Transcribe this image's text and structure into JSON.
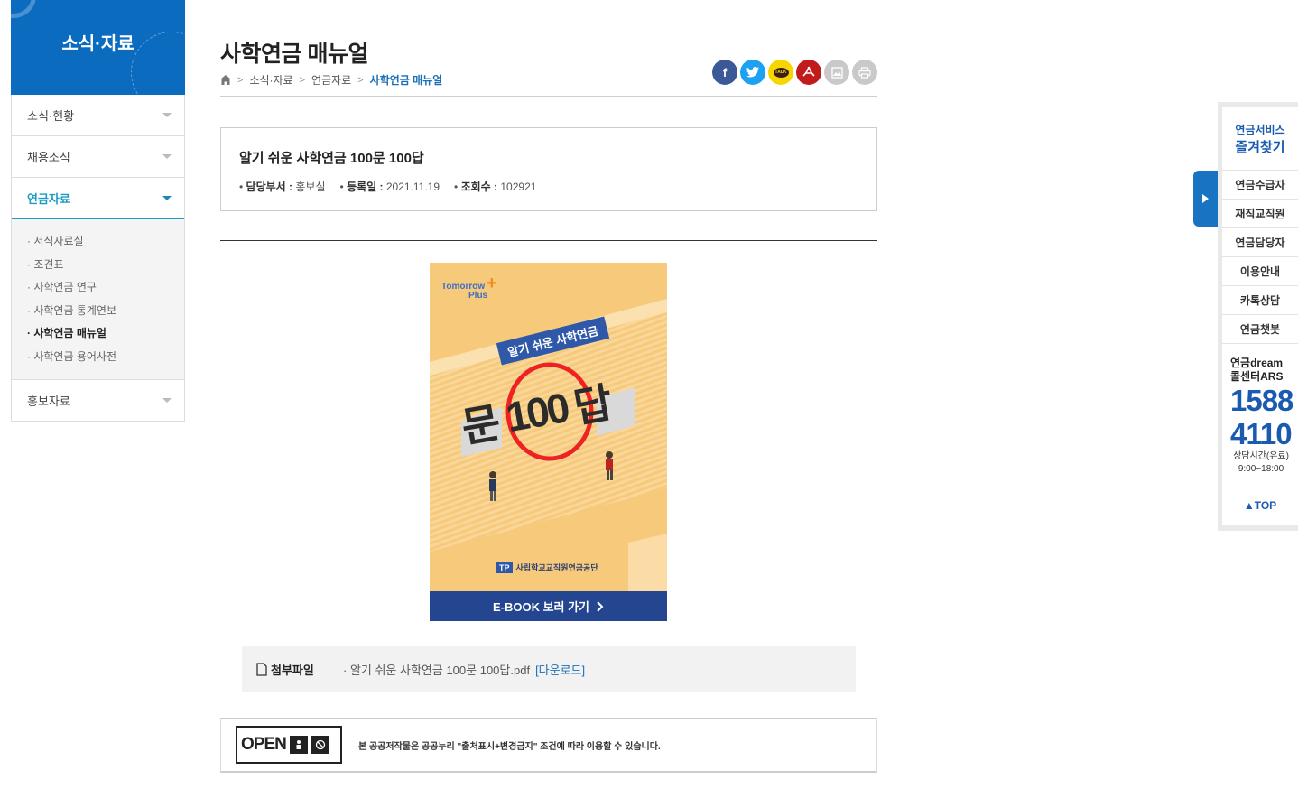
{
  "sidebar": {
    "title": "소식·자료",
    "items": [
      {
        "label": "소식·현황"
      },
      {
        "label": "채용소식"
      },
      {
        "label": "연금자료"
      },
      {
        "label": "홍보자료"
      }
    ],
    "sub_items": [
      {
        "label": "· 서식자료실"
      },
      {
        "label": "· 조견표"
      },
      {
        "label": "· 사학연금 연구"
      },
      {
        "label": "· 사학연금 통계연보"
      },
      {
        "label": "· 사학연금 매뉴얼"
      },
      {
        "label": "· 사학연금 용어사전"
      }
    ]
  },
  "page": {
    "title": "사학연금 매뉴얼",
    "breadcrumb": [
      "소식·자료",
      "연금자료",
      "사학연금 매뉴얼"
    ]
  },
  "share": {
    "facebook": "f",
    "twitter": "t",
    "kakao": "TALK"
  },
  "post": {
    "title": "알기 쉬운 사학연금 100문 100답",
    "dept_label": "담당부서 :",
    "dept": "홍보실",
    "date_label": "등록일 :",
    "date": "2021.11.19",
    "views_label": "조회수 :",
    "views": "102921"
  },
  "cover": {
    "brand1": "Tomorrow",
    "brand2": "Plus",
    "ribbon": "알기 쉬운 사학연금",
    "big_left": "문",
    "big_mid": "100",
    "big_right": "답",
    "org": "사립학교교직원연금공단",
    "org_logo": "TP",
    "button": "E-BOOK 보러 가기"
  },
  "attachment": {
    "label": "첨부파일",
    "file": "· 알기 쉬운 사학연금 100문 100답.pdf",
    "download": "[다운로드]"
  },
  "license": {
    "open": "OPEN",
    "text": "본 공공저작물은 공공누리 \"출처표시+변경금지\" 조건에 따라 이용할 수 있습니다."
  },
  "quick": {
    "head1": "연금서비스",
    "head2": "즐겨찾기",
    "items": [
      {
        "label": "연금수급자"
      },
      {
        "label": "재직교직원"
      },
      {
        "label": "연금담당자"
      },
      {
        "label": "이용안내"
      },
      {
        "label": "카톡상담"
      },
      {
        "label": "연금챗봇"
      }
    ],
    "ars1": "연금dream",
    "ars2": "콜센터ARS",
    "num1": "1588",
    "num2": "4110",
    "hours_label": "상담시간(유료)",
    "hours": "9:00~18:00",
    "top": "▲TOP"
  },
  "colors": {
    "brand_blue": "#0b6bbf",
    "active_teal": "#1f9ac4",
    "cover_bg": "#f7c97a",
    "cover_button": "#24458f",
    "facebook": "#3b5998",
    "twitter": "#1da1f2",
    "kakao": "#f7d600",
    "pdf": "#c21b1b"
  }
}
